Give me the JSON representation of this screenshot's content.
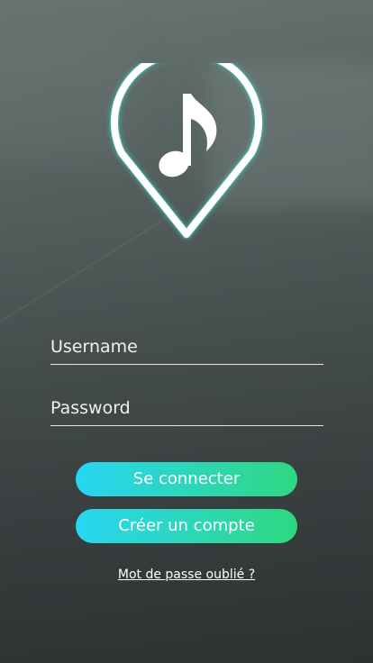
{
  "app": {
    "logo_icon": "music-note-map-pin-icon",
    "accent_color": "#2ed7a4",
    "gradient_start": "#27d6f3",
    "gradient_end": "#2fd77f"
  },
  "login_form": {
    "username_placeholder": "Username",
    "password_placeholder": "Password",
    "username_value": "",
    "password_value": ""
  },
  "actions": {
    "login_label": "Se connecter",
    "register_label": "Créer un compte",
    "forgot_password_label": "Mot de passe oublié ?"
  }
}
